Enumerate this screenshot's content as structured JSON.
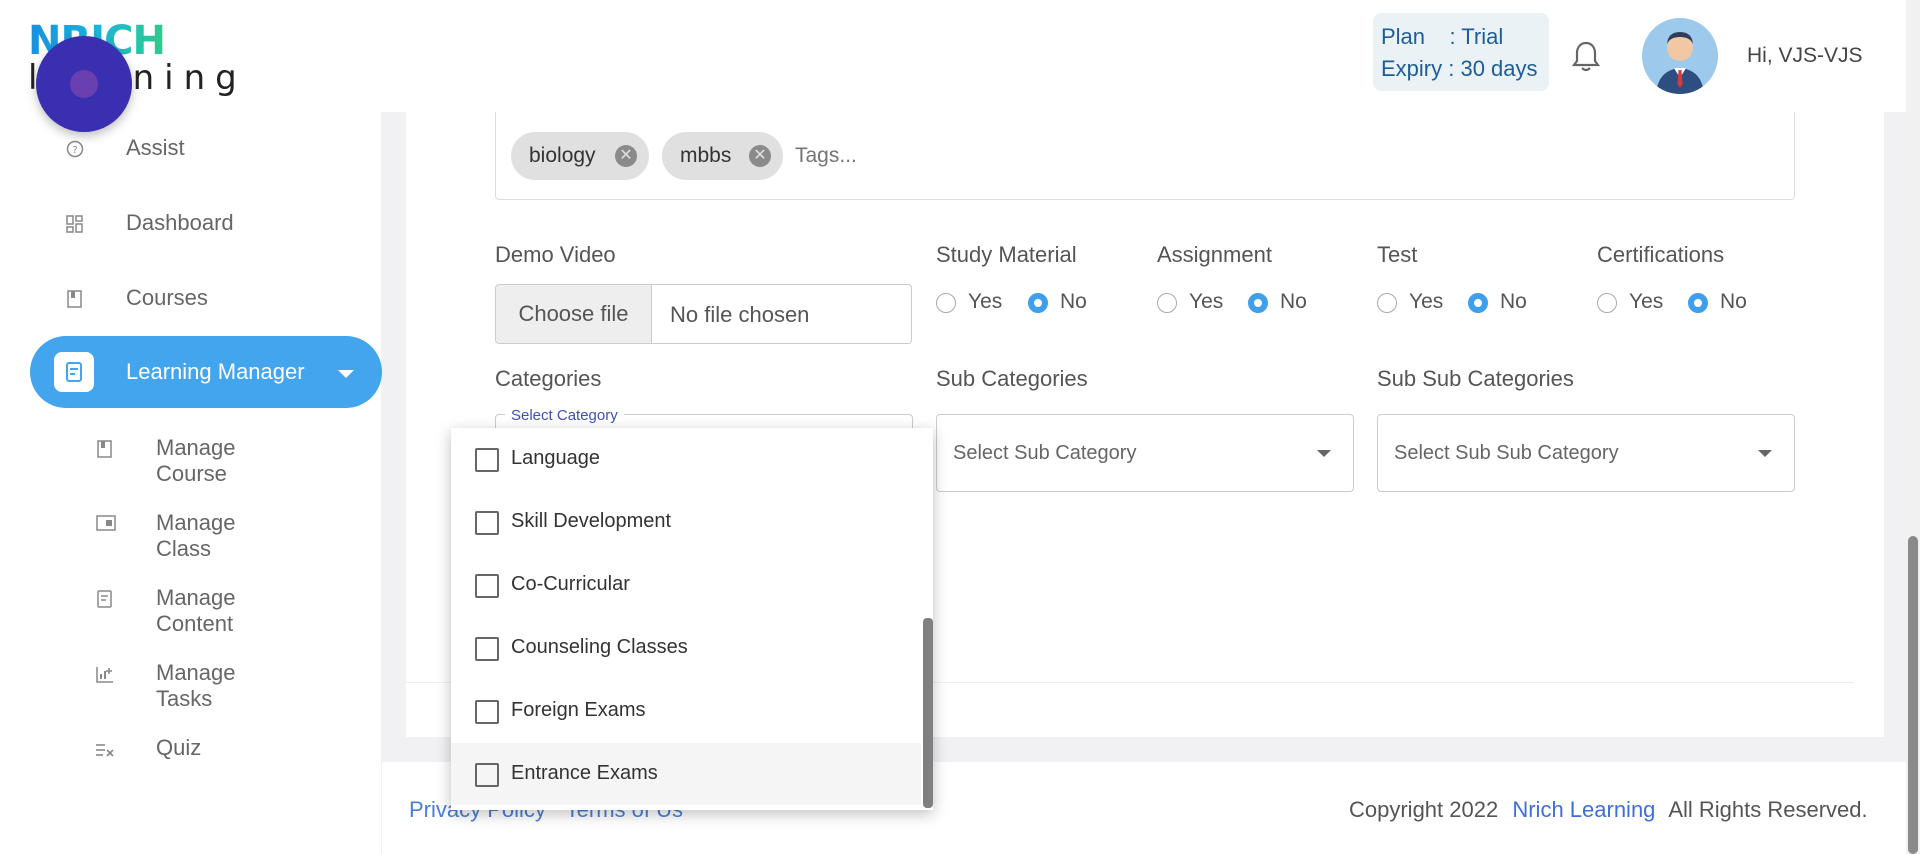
{
  "header": {
    "logo_top": "NRICH",
    "logo_bottom": "learning",
    "plan_line": "Plan    : Trial",
    "expiry_line": "Expiry : 30 days",
    "greeting": "Hi, VJS-VJS"
  },
  "sidebar": {
    "items": [
      {
        "label": "Assist",
        "icon": "help-icon"
      },
      {
        "label": "Dashboard",
        "icon": "dashboard-icon"
      },
      {
        "label": "Courses",
        "icon": "book-icon"
      },
      {
        "label": "Learning Manager",
        "icon": "document-icon",
        "active": true
      },
      {
        "label": "Manage Course",
        "icon": "book-icon"
      },
      {
        "label": "Manage Class",
        "icon": "cast-icon"
      },
      {
        "label": "Manage Content",
        "icon": "document-icon"
      },
      {
        "label": "Manage Tasks",
        "icon": "chart-add-icon"
      },
      {
        "label": "Quiz",
        "icon": "list-check-icon"
      }
    ]
  },
  "form": {
    "tags": [
      "biology",
      "mbbs"
    ],
    "tags_placeholder": "Tags...",
    "demo_video_label": "Demo Video",
    "file_button": "Choose file",
    "file_status": "No file chosen",
    "options": [
      {
        "label": "Study Material",
        "yes": "Yes",
        "no": "No",
        "selected": "No"
      },
      {
        "label": "Assignment",
        "yes": "Yes",
        "no": "No",
        "selected": "No"
      },
      {
        "label": "Test",
        "yes": "Yes",
        "no": "No",
        "selected": "No"
      },
      {
        "label": "Certifications",
        "yes": "Yes",
        "no": "No",
        "selected": "No"
      }
    ],
    "categories_label": "Categories",
    "category_float": "Select Category",
    "sub_categories_label": "Sub Categories",
    "sub_category_placeholder": "Select Sub Category",
    "sub_sub_categories_label": "Sub Sub Categories",
    "sub_sub_category_placeholder": "Select Sub Sub Category"
  },
  "dropdown": {
    "items": [
      "Language",
      "Skill Development",
      "Co-Curricular",
      "Counseling Classes",
      "Foreign Exams",
      "Entrance Exams"
    ],
    "highlighted": "Entrance Exams"
  },
  "footer": {
    "privacy": "Privacy Policy",
    "terms": "Terms of Us",
    "copyright_prefix": "Copyright 2022",
    "brand": "Nrich Learning",
    "copyright_suffix": "All Rights Reserved."
  }
}
